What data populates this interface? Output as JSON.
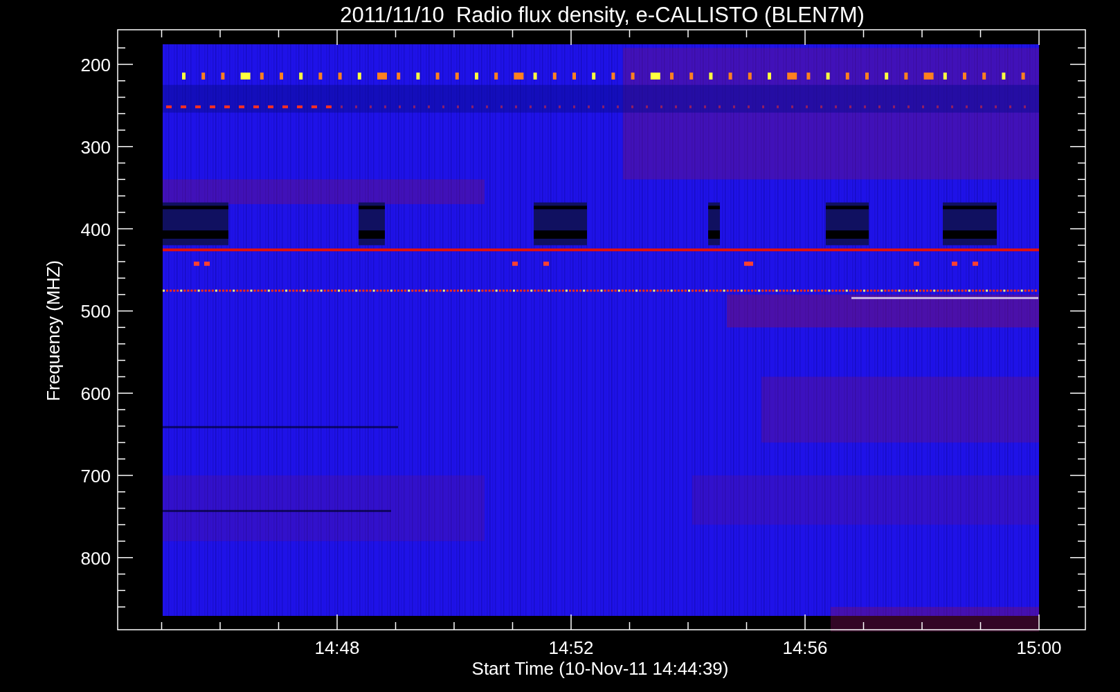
{
  "title": "2011/11/10  Radio flux density, e-CALLISTO (BLEN7M)",
  "y_axis": {
    "label": "Frequency (MHZ)",
    "ticks": [
      "200",
      "300",
      "400",
      "500",
      "600",
      "700",
      "800"
    ]
  },
  "x_axis": {
    "label": "Start Time (10-Nov-11 14:44:39)",
    "ticks": [
      "14:48",
      "14:52",
      "14:56",
      "15:00"
    ]
  }
}
